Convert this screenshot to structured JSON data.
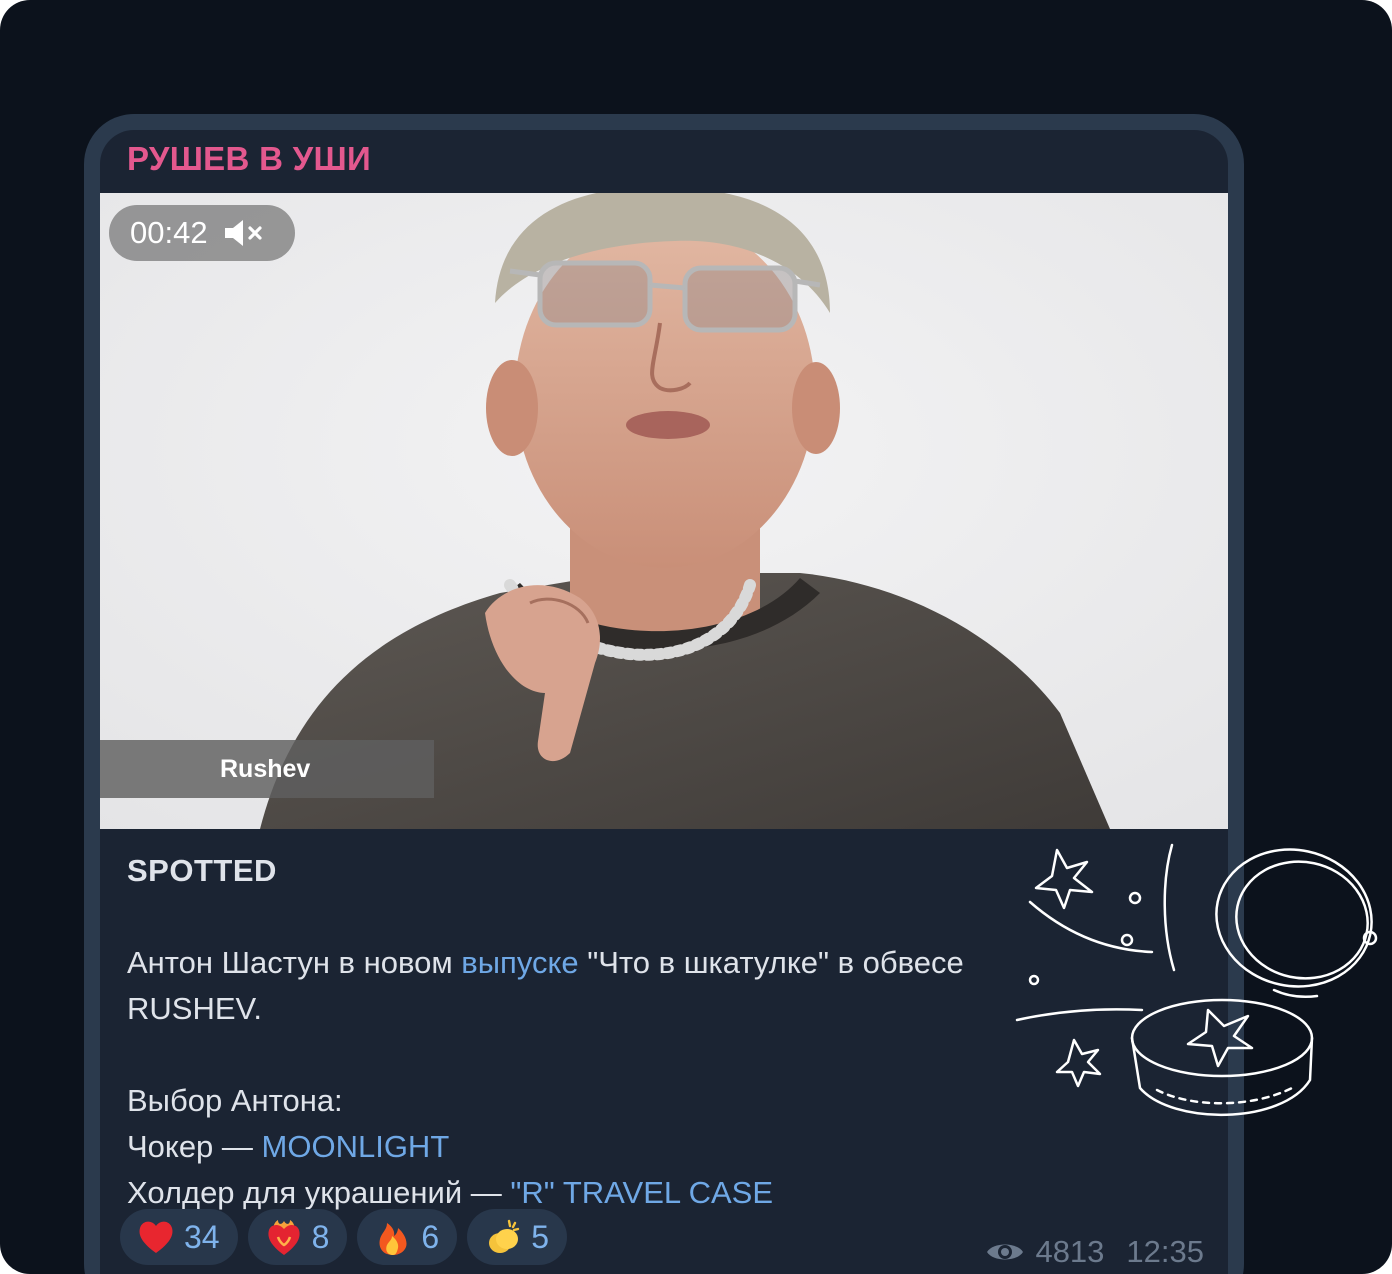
{
  "post": {
    "channel_name": "РУШЕВ В УШИ",
    "video": {
      "duration": "00:42",
      "muted": true,
      "lower_third": "Rushev"
    },
    "caption": {
      "title": "SPOTTED",
      "line1_before": "Антон Шастун в новом ",
      "line1_link": "выпуске",
      "line1_after": " \"Что в шкатулке\" в обвесе",
      "line2": "RUSHEV.",
      "choice_heading": "Выбор Антона:",
      "item1_label": "Чокер — ",
      "item1_link": "MOONLIGHT",
      "item2_label": "Холдер для украшений — ",
      "item2_link": "\"R\" TRAVEL CASE"
    },
    "reactions": [
      {
        "emoji": "red-heart-icon",
        "count": "34"
      },
      {
        "emoji": "heart-on-fire-icon",
        "count": "8"
      },
      {
        "emoji": "fire-icon",
        "count": "6"
      },
      {
        "emoji": "clapping-hands-icon",
        "count": "5"
      }
    ],
    "views": "4813",
    "time": "12:35"
  },
  "colors": {
    "background": "#0c121c",
    "bubble": "#1b2433",
    "channel_name": "#e3588e",
    "link": "#6fa8e6",
    "reaction_count": "#7fb3ec",
    "meta": "#6c7a8d"
  }
}
